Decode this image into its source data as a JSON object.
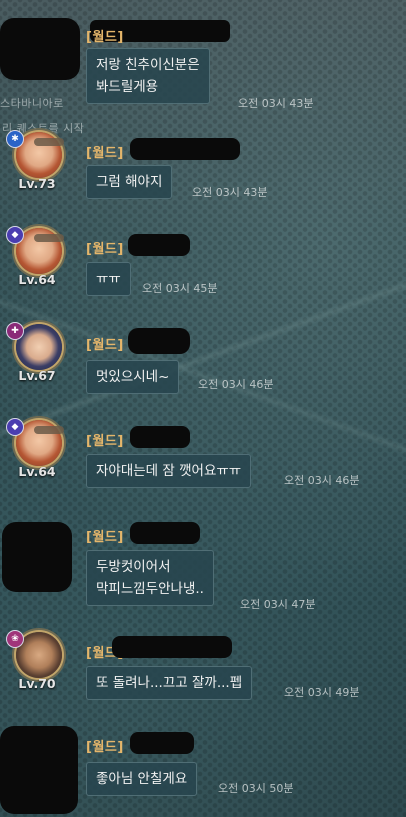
{
  "system": {
    "line1": "스타바니아로",
    "line2": "리 퀘스트를 시작"
  },
  "messages": [
    {
      "channel": "[월드]",
      "text": "저랑 친추이신분은\n봐드릴게용",
      "time": "오전 03시 43분",
      "level": ""
    },
    {
      "channel": "[월드]",
      "text": "그럼 해야지",
      "time": "오전 03시 43분",
      "level": "Lv.73"
    },
    {
      "channel": "[월드]",
      "text": "ㅠㅠ",
      "time": "오전 03시 45분",
      "level": "Lv.64"
    },
    {
      "channel": "[월드]",
      "text": "멋있으시네~",
      "time": "오전 03시 46분",
      "level": "Lv.67"
    },
    {
      "channel": "[월드]",
      "text": "자야대는데 잠 깻어요ㅠㅠ",
      "time": "오전 03시 46분",
      "level": "Lv.64"
    },
    {
      "channel": "[월드]",
      "text": "두방컷이어서\n막피느낌두안나냉..",
      "time": "오전 03시 47분",
      "level": ""
    },
    {
      "channel": "[월드]",
      "text": "또 돌려나...끄고 잘까...펩",
      "time": "오전 03시 49분",
      "level": "Lv.70"
    },
    {
      "channel": "[월드]",
      "text": "좋아님 안칠게요",
      "time": "오전 03시 50분",
      "level": ""
    }
  ],
  "icons": {
    "badge_1": "paw-icon",
    "badge_2": "shield-icon",
    "badge_3": "cross-icon",
    "badge_4": "shield-icon",
    "badge_5": "flower-icon"
  }
}
